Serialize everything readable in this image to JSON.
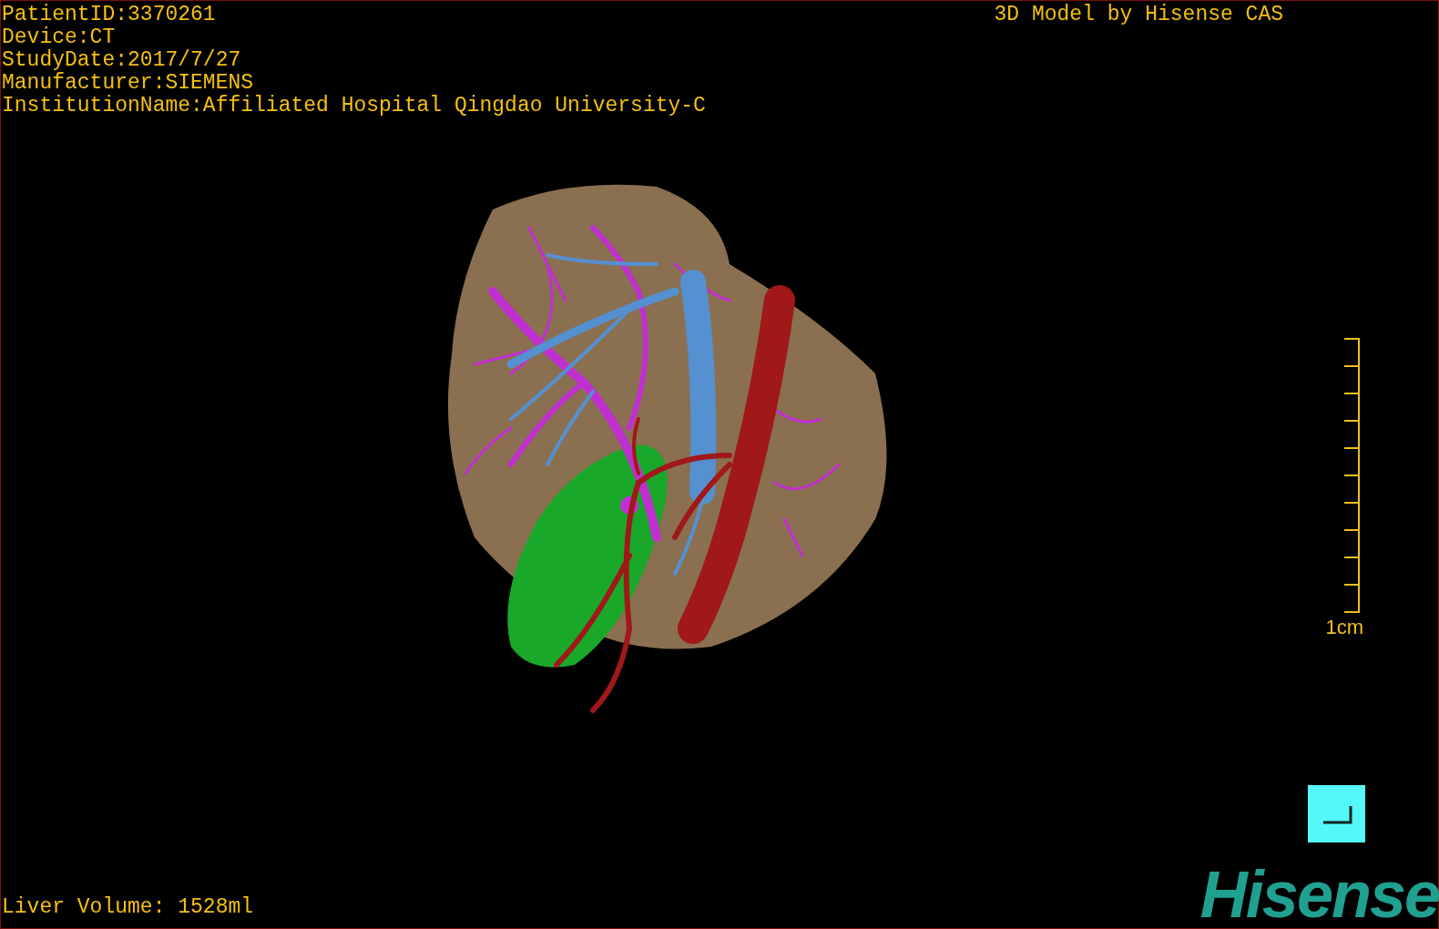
{
  "study_info": [
    "PatientID:3370261",
    "Device:CT",
    "StudyDate:2017/7/27",
    "Manufacturer:SIEMENS",
    "InstitutionName:Affiliated Hospital Qingdao University-C"
  ],
  "title": "3D Model by Hisense CAS",
  "scale_bar": {
    "label": "1cm"
  },
  "liver_volume": "Liver Volume: 1528ml",
  "logo": "Hisense"
}
